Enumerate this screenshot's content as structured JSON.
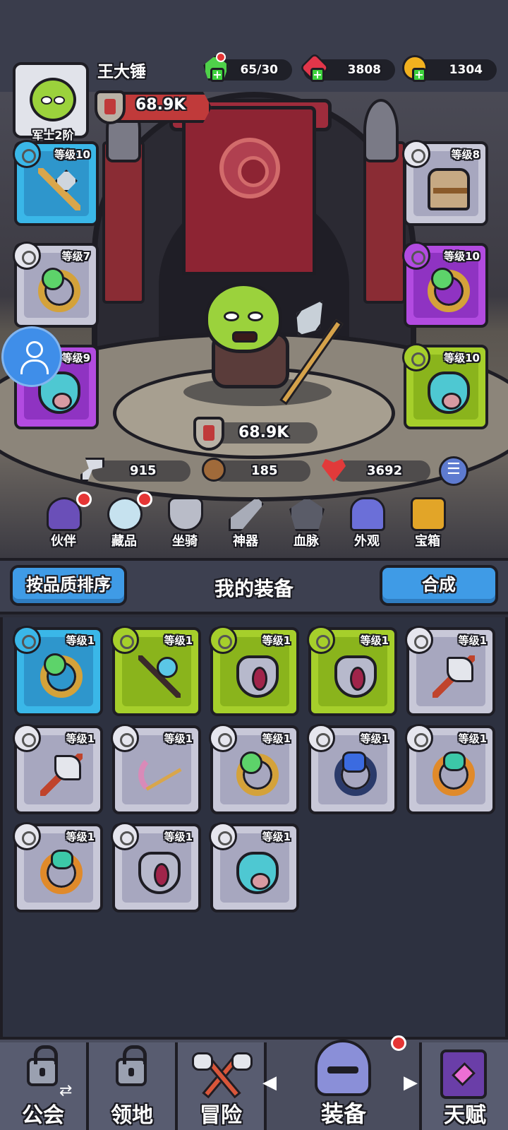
{
  "player": {
    "name": "王大锤",
    "rank": "军士2阶",
    "power": "68.9K"
  },
  "resources": [
    {
      "name": "stamina",
      "value": "65/30",
      "color": "#4fd14a"
    },
    {
      "name": "gems",
      "value": "3808",
      "color": "#e2364a"
    },
    {
      "name": "gold",
      "value": "1304",
      "color": "#f2b11f"
    }
  ],
  "equipped": {
    "left": [
      {
        "level": "等级10",
        "rarity": "blue",
        "item": "spear"
      },
      {
        "level": "等级7",
        "rarity": "gray",
        "item": "ring"
      },
      {
        "level": "等级9",
        "rarity": "purple",
        "item": "mask"
      }
    ],
    "right": [
      {
        "level": "等级8",
        "rarity": "gray",
        "item": "armor"
      },
      {
        "level": "等级10",
        "rarity": "purple",
        "item": "ring"
      },
      {
        "level": "等级10",
        "rarity": "green",
        "item": "mask"
      }
    ]
  },
  "hero": {
    "power": "68.9K"
  },
  "stats": {
    "attack": "915",
    "defense": "185",
    "hp": "3692"
  },
  "features": [
    "伙伴",
    "藏品",
    "坐骑",
    "神器",
    "血脉",
    "外观",
    "宝箱"
  ],
  "bag": {
    "sort_label": "按品质排序",
    "title": "我的装备",
    "merge_label": "合成",
    "items": [
      {
        "level": "等级1",
        "rarity": "blue",
        "item": "ring"
      },
      {
        "level": "等级1",
        "rarity": "green",
        "item": "staff"
      },
      {
        "level": "等级1",
        "rarity": "green",
        "item": "gray-mask"
      },
      {
        "level": "等级1",
        "rarity": "green",
        "item": "gray-mask"
      },
      {
        "level": "等级1",
        "rarity": "gray",
        "item": "axe"
      },
      {
        "level": "等级1",
        "rarity": "gray",
        "item": "axe"
      },
      {
        "level": "等级1",
        "rarity": "gray",
        "item": "bow"
      },
      {
        "level": "等级1",
        "rarity": "gray",
        "item": "ring"
      },
      {
        "level": "等级1",
        "rarity": "gray",
        "item": "dark-ring"
      },
      {
        "level": "等级1",
        "rarity": "gray",
        "item": "orange-ring"
      },
      {
        "level": "等级1",
        "rarity": "gray",
        "item": "orange-ring"
      },
      {
        "level": "等级1",
        "rarity": "gray",
        "item": "gray-mask"
      },
      {
        "level": "等级1",
        "rarity": "gray",
        "item": "mask"
      }
    ]
  },
  "nav": [
    {
      "label": "公会",
      "locked": true
    },
    {
      "label": "领地",
      "locked": true
    },
    {
      "label": "冒险",
      "locked": false
    },
    {
      "label": "装备",
      "locked": false,
      "active": true
    },
    {
      "label": "天赋",
      "locked": false
    }
  ]
}
